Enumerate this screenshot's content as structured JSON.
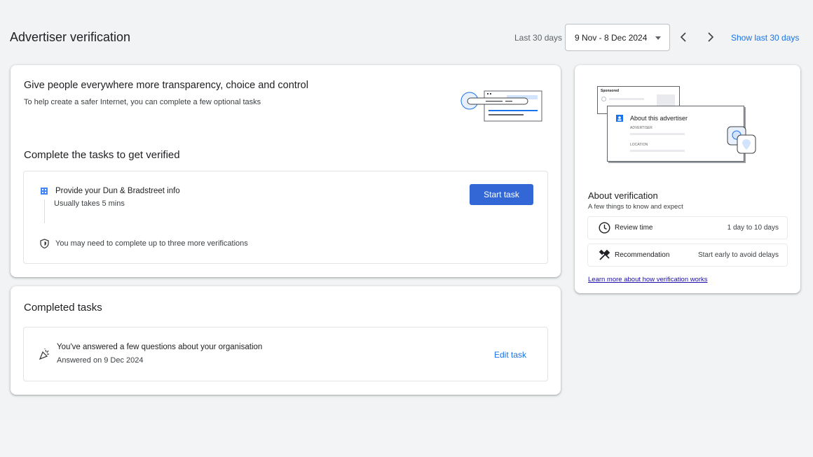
{
  "header": {
    "title": "Advertiser verification",
    "range_label": "Last 30 days",
    "date_value": "9 Nov - 8 Dec 2024",
    "show_last": "Show last 30 days"
  },
  "main_card": {
    "heading": "Give people everywhere more transparency, choice and control",
    "subtext": "To help create a safer Internet, you can complete a few optional tasks",
    "tasks_heading": "Complete the tasks to get verified",
    "task_title": "Provide your Dun & Bradstreet info",
    "task_duration": "Usually takes 5 mins",
    "start_button": "Start task",
    "more_note": "You may need to complete up to three more verifications"
  },
  "completed_card": {
    "heading": "Completed tasks",
    "task_title": "You've answered a few questions about your organisation",
    "task_date": "Answered on 9 Dec 2024",
    "edit_button": "Edit task"
  },
  "side_card": {
    "illustration": {
      "sponsored": "Sponsored",
      "about_advertiser": "About this advertiser",
      "advertiser_caption": "ADVERTISER",
      "location_caption": "LOCATION"
    },
    "title": "About verification",
    "subtitle": "A few things to know and expect",
    "rows": [
      {
        "icon": "clock-icon",
        "label": "Review time",
        "value": "1 day to 10 days"
      },
      {
        "icon": "tools-icon",
        "label": "Recommendation",
        "value": "Start early to avoid delays"
      }
    ],
    "learn_more": "Learn more about how verification works"
  },
  "colors": {
    "accent": "#1a73e8",
    "button": "#3367d6",
    "background": "#f1f3f4"
  }
}
